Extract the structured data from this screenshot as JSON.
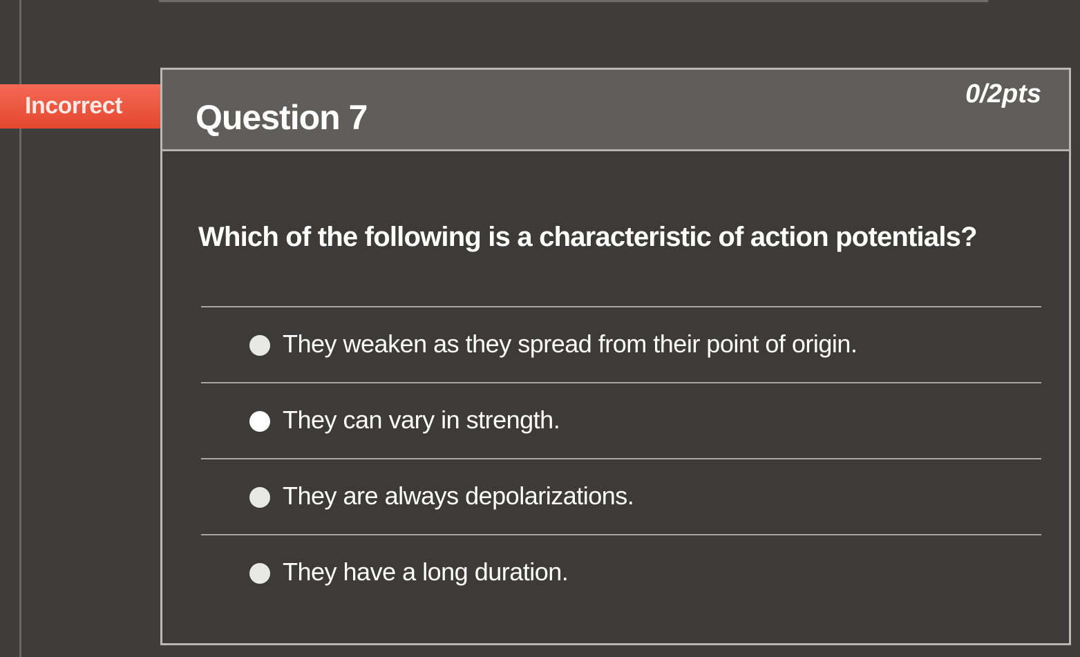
{
  "status": {
    "label": "Incorrect",
    "color": "#e94c34"
  },
  "question": {
    "title": "Question 7",
    "points": "0/2pts",
    "prompt": "Which of the following is a characteristic of action potentials?",
    "answers": [
      {
        "label": "They weaken as they spread from their point of origin.",
        "selected": false
      },
      {
        "label": "They can vary in strength.",
        "selected": true
      },
      {
        "label": "They are always depolarizations.",
        "selected": false
      },
      {
        "label": "They have a long duration.",
        "selected": false
      }
    ]
  }
}
